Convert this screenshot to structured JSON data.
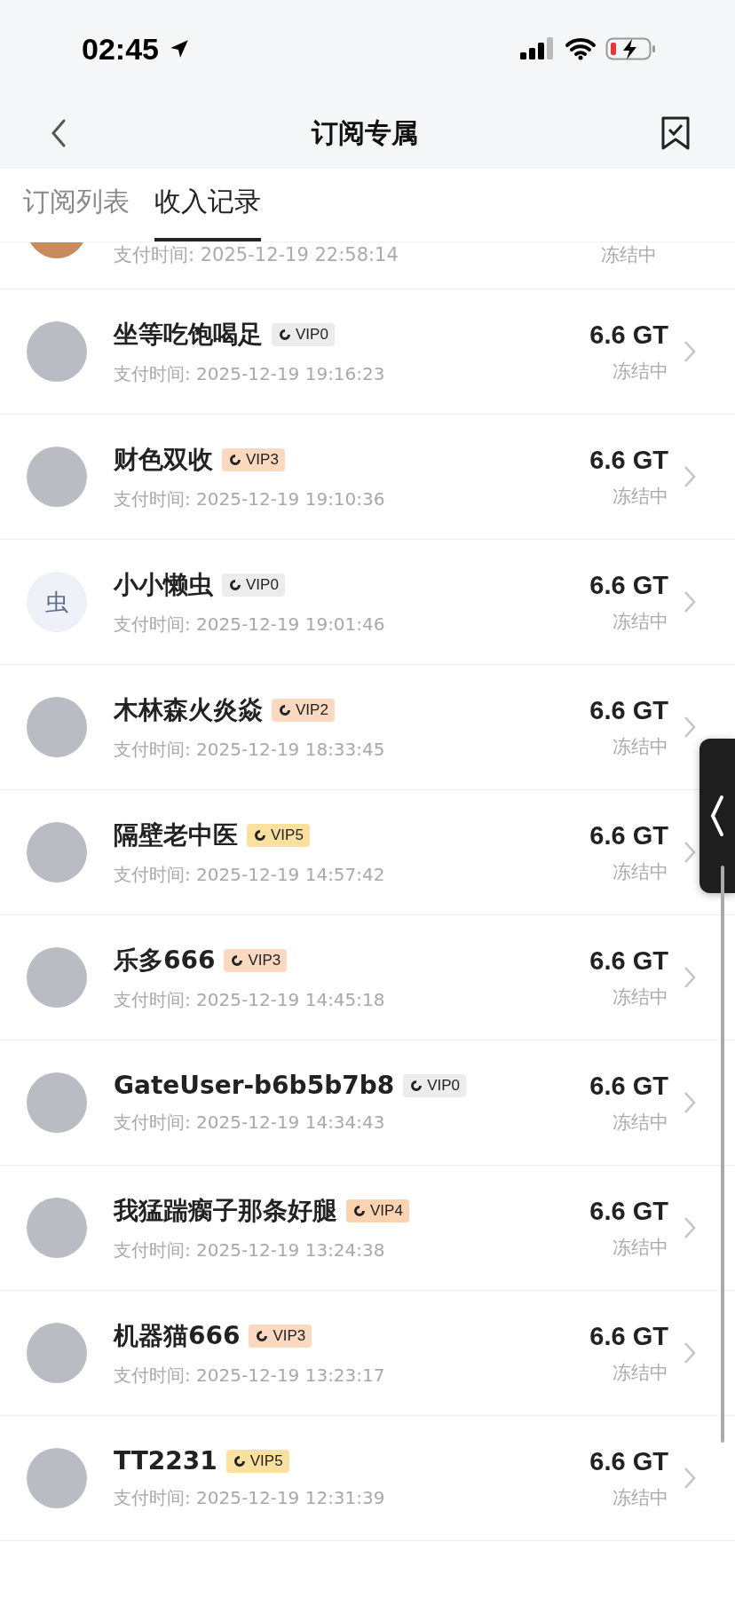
{
  "status_bar": {
    "time": "02:45"
  },
  "nav": {
    "title": "订阅专属"
  },
  "tabs": [
    {
      "label": "订阅列表",
      "selected": false
    },
    {
      "label": "收入记录",
      "selected": true
    }
  ],
  "partial_row": {
    "time": "支付时间: 2025-12-19 22:58:14",
    "status": "冻结中"
  },
  "rows": [
    {
      "name": "坐等吃饱喝足",
      "kind": "photo",
      "vip": "VIP0",
      "color": "#ececec",
      "time": "支付时间: 2025-12-19 19:16:23",
      "amount": "6.6 GT",
      "status": "冻结中"
    },
    {
      "name": "财色双收",
      "kind": "photo",
      "vip": "VIP3",
      "color": "#fbd9c0",
      "time": "支付时间: 2025-12-19 19:10:36",
      "amount": "6.6 GT",
      "status": "冻结中"
    },
    {
      "name": "小小懒虫",
      "kind": "letter",
      "avatar_text": "虫",
      "vip": "VIP0",
      "color": "#ececec",
      "time": "支付时间: 2025-12-19 19:01:46",
      "amount": "6.6 GT",
      "status": "冻结中"
    },
    {
      "name": "木林森火炎焱",
      "kind": "photo",
      "vip": "VIP2",
      "color": "#fbd9c0",
      "time": "支付时间: 2025-12-19 18:33:45",
      "amount": "6.6 GT",
      "status": "冻结中"
    },
    {
      "name": "隔壁老中医",
      "kind": "photo",
      "vip": "VIP5",
      "color": "#fbe0a0",
      "time": "支付时间: 2025-12-19 14:57:42",
      "amount": "6.6 GT",
      "status": "冻结中"
    },
    {
      "name": "乐多666",
      "kind": "photo",
      "vip": "VIP3",
      "color": "#fbd9c0",
      "time": "支付时间: 2025-12-19 14:45:18",
      "amount": "6.6 GT",
      "status": "冻结中"
    },
    {
      "name": "GateUser-b6b5b7b8",
      "kind": "photo",
      "vip": "VIP0",
      "color": "#ececec",
      "time": "支付时间: 2025-12-19 14:34:43",
      "amount": "6.6 GT",
      "status": "冻结中"
    },
    {
      "name": "我猛踹瘸子那条好腿",
      "kind": "photo",
      "vip": "VIP4",
      "color": "#fcd3b0",
      "time": "支付时间: 2025-12-19 13:24:38",
      "amount": "6.6 GT",
      "status": "冻结中"
    },
    {
      "name": "机器猫666",
      "kind": "photo",
      "vip": "VIP3",
      "color": "#fbd9c0",
      "time": "支付时间: 2025-12-19 13:23:17",
      "amount": "6.6 GT",
      "status": "冻结中"
    },
    {
      "name": "TT2231",
      "kind": "photo",
      "vip": "VIP5",
      "color": "#fbe0a0",
      "time": "支付时间: 2025-12-19 12:31:39",
      "amount": "6.6 GT",
      "status": "冻结中"
    }
  ]
}
